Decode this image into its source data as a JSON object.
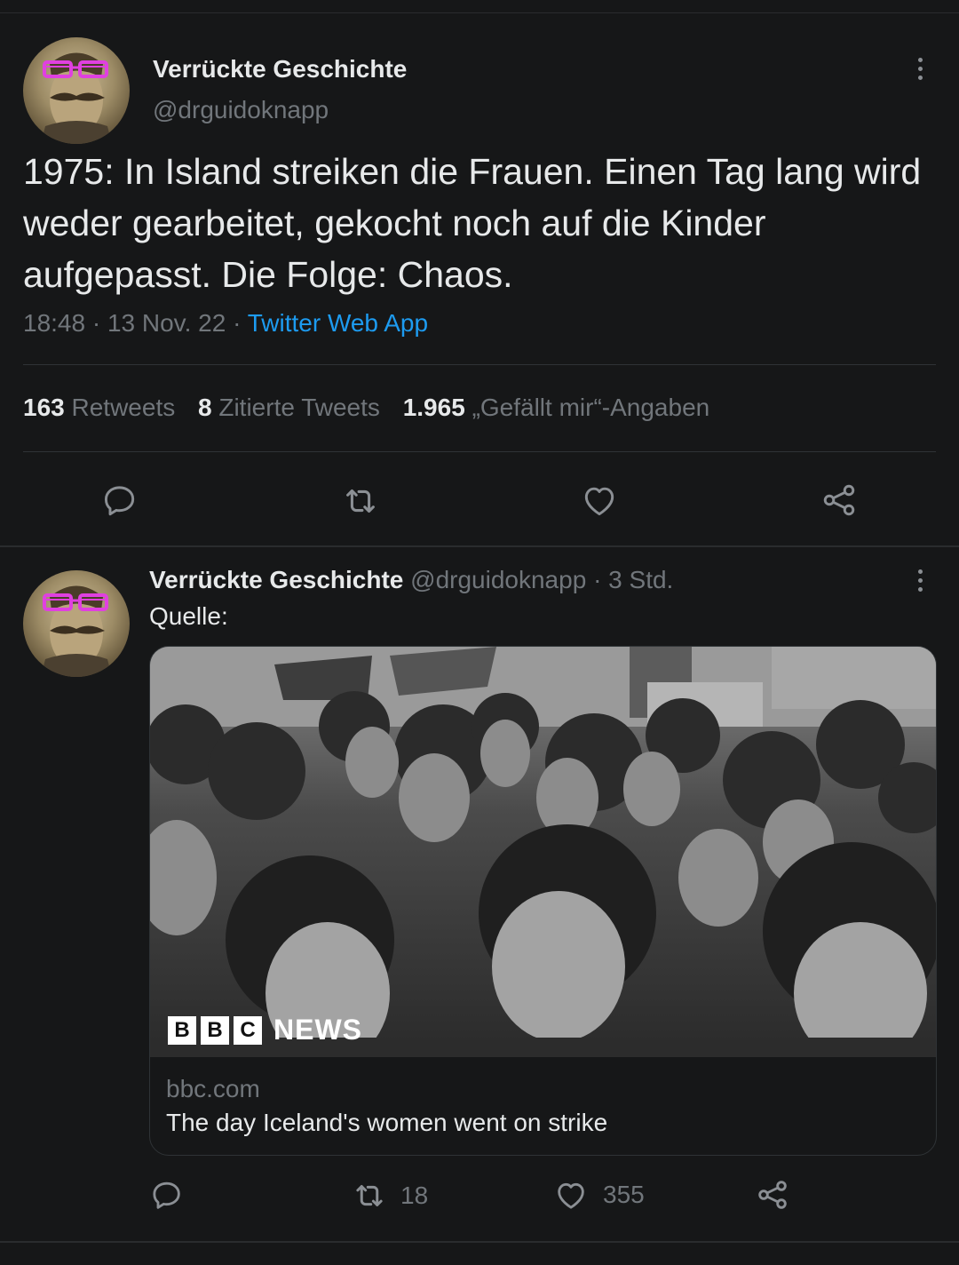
{
  "tweet": {
    "author_name": "Verrückte Geschichte",
    "handle": "@drguidoknapp",
    "text": "1975: In Island streiken die Frauen. Einen Tag lang wird weder gearbeitet, gekocht noch auf die Kinder aufgepasst. Die Folge: Chaos.",
    "time": "18:48",
    "sep1": "·",
    "date": "13 Nov. 22",
    "sep2": "·",
    "source": "Twitter Web App",
    "stats": {
      "retweets_count": "163",
      "retweets_label": "Retweets",
      "quotes_count": "8",
      "quotes_label": "Zitierte Tweets",
      "likes_count": "1.965",
      "likes_label": "„Gefällt mir“-Angaben"
    }
  },
  "reply": {
    "author_name": "Verrückte Geschichte",
    "handle": "@drguidoknapp",
    "sep": "·",
    "age": "3 Std.",
    "text": "Quelle:",
    "card": {
      "logo_letters": [
        "B",
        "B",
        "C"
      ],
      "logo_news": "NEWS",
      "domain": "bbc.com",
      "title": "The day Iceland's women went on strike"
    },
    "retweet_count": "18",
    "like_count": "355"
  },
  "colors": {
    "background": "#161718",
    "text": "#e7e9ea",
    "muted": "#71767b",
    "link": "#1d9bf0",
    "avatar_glasses": "#e040e0"
  },
  "icons": [
    "reply-icon",
    "retweet-icon",
    "like-icon",
    "share-icon",
    "more-icon"
  ]
}
